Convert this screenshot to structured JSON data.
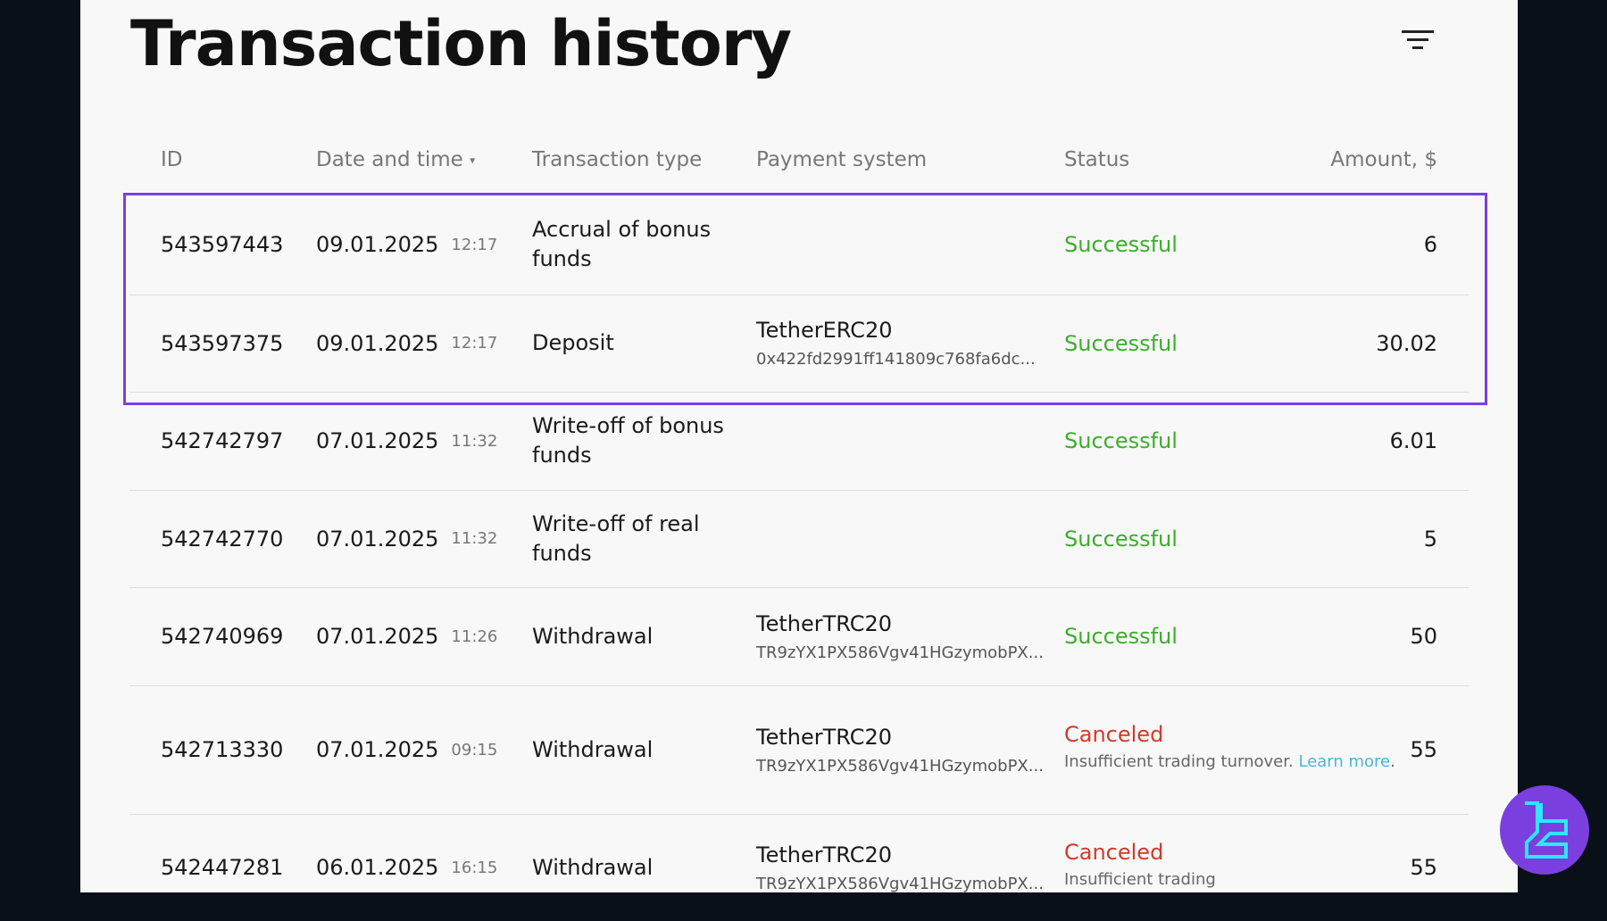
{
  "page": {
    "title": "Transaction history",
    "filter_icon": "filter-icon"
  },
  "columns": [
    "ID",
    "Date and time",
    "Transaction type",
    "Payment system",
    "Status",
    "Amount, $"
  ],
  "rows": [
    {
      "id": "543597443",
      "date": "09.01.2025",
      "time": "12:17",
      "type": "Accrual of bonus funds",
      "payment": "",
      "address": "",
      "status": "Successful",
      "note": "",
      "link": "",
      "amount": "6"
    },
    {
      "id": "543597375",
      "date": "09.01.2025",
      "time": "12:17",
      "type": "Deposit",
      "payment": "TetherERC20",
      "address": "0x422fd2991ff141809c768fa6dc...",
      "status": "Successful",
      "note": "",
      "link": "",
      "amount": "30.02"
    },
    {
      "id": "542742797",
      "date": "07.01.2025",
      "time": "11:32",
      "type": "Write-off of bonus funds",
      "payment": "",
      "address": "",
      "status": "Successful",
      "note": "",
      "link": "",
      "amount": "6.01"
    },
    {
      "id": "542742770",
      "date": "07.01.2025",
      "time": "11:32",
      "type": "Write-off of real funds",
      "payment": "",
      "address": "",
      "status": "Successful",
      "note": "",
      "link": "",
      "amount": "5"
    },
    {
      "id": "542740969",
      "date": "07.01.2025",
      "time": "11:26",
      "type": "Withdrawal",
      "payment": "TetherTRC20",
      "address": "TR9zYX1PX586Vgv41HGzymobPX...",
      "status": "Successful",
      "note": "",
      "link": "",
      "amount": "50"
    },
    {
      "id": "542713330",
      "date": "07.01.2025",
      "time": "09:15",
      "type": "Withdrawal",
      "payment": "TetherTRC20",
      "address": "TR9zYX1PX586Vgv41HGzymobPX...",
      "status": "Canceled",
      "note": "Insufficient trading turnover.",
      "link": "Learn more",
      "amount": "55"
    },
    {
      "id": "542447281",
      "date": "06.01.2025",
      "time": "16:15",
      "type": "Withdrawal",
      "payment": "TetherTRC20",
      "address": "TR9zYX1PX586Vgv41HGzymobPX...",
      "status": "Canceled",
      "note": "Insufficient trading",
      "link": "",
      "amount": "55"
    }
  ],
  "colors": {
    "success": "#3cae2a",
    "canceled": "#d13a2a",
    "highlight": "#7b3fe0",
    "link": "#49b6d6"
  }
}
